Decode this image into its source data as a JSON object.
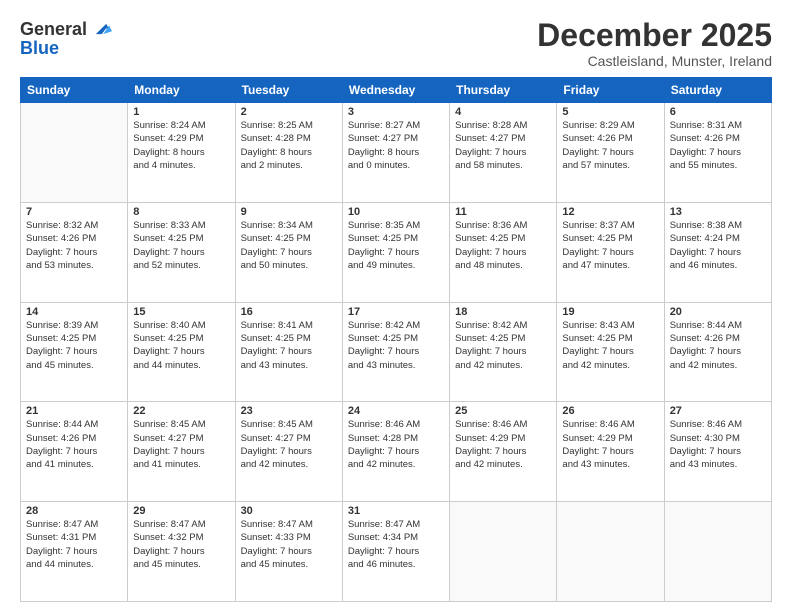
{
  "header": {
    "logo_general": "General",
    "logo_blue": "Blue",
    "month_title": "December 2025",
    "subtitle": "Castleisland, Munster, Ireland"
  },
  "days_of_week": [
    "Sunday",
    "Monday",
    "Tuesday",
    "Wednesday",
    "Thursday",
    "Friday",
    "Saturday"
  ],
  "weeks": [
    [
      {
        "day": "",
        "content": ""
      },
      {
        "day": "1",
        "content": "Sunrise: 8:24 AM\nSunset: 4:29 PM\nDaylight: 8 hours\nand 4 minutes."
      },
      {
        "day": "2",
        "content": "Sunrise: 8:25 AM\nSunset: 4:28 PM\nDaylight: 8 hours\nand 2 minutes."
      },
      {
        "day": "3",
        "content": "Sunrise: 8:27 AM\nSunset: 4:27 PM\nDaylight: 8 hours\nand 0 minutes."
      },
      {
        "day": "4",
        "content": "Sunrise: 8:28 AM\nSunset: 4:27 PM\nDaylight: 7 hours\nand 58 minutes."
      },
      {
        "day": "5",
        "content": "Sunrise: 8:29 AM\nSunset: 4:26 PM\nDaylight: 7 hours\nand 57 minutes."
      },
      {
        "day": "6",
        "content": "Sunrise: 8:31 AM\nSunset: 4:26 PM\nDaylight: 7 hours\nand 55 minutes."
      }
    ],
    [
      {
        "day": "7",
        "content": "Sunrise: 8:32 AM\nSunset: 4:26 PM\nDaylight: 7 hours\nand 53 minutes."
      },
      {
        "day": "8",
        "content": "Sunrise: 8:33 AM\nSunset: 4:25 PM\nDaylight: 7 hours\nand 52 minutes."
      },
      {
        "day": "9",
        "content": "Sunrise: 8:34 AM\nSunset: 4:25 PM\nDaylight: 7 hours\nand 50 minutes."
      },
      {
        "day": "10",
        "content": "Sunrise: 8:35 AM\nSunset: 4:25 PM\nDaylight: 7 hours\nand 49 minutes."
      },
      {
        "day": "11",
        "content": "Sunrise: 8:36 AM\nSunset: 4:25 PM\nDaylight: 7 hours\nand 48 minutes."
      },
      {
        "day": "12",
        "content": "Sunrise: 8:37 AM\nSunset: 4:25 PM\nDaylight: 7 hours\nand 47 minutes."
      },
      {
        "day": "13",
        "content": "Sunrise: 8:38 AM\nSunset: 4:24 PM\nDaylight: 7 hours\nand 46 minutes."
      }
    ],
    [
      {
        "day": "14",
        "content": "Sunrise: 8:39 AM\nSunset: 4:25 PM\nDaylight: 7 hours\nand 45 minutes."
      },
      {
        "day": "15",
        "content": "Sunrise: 8:40 AM\nSunset: 4:25 PM\nDaylight: 7 hours\nand 44 minutes."
      },
      {
        "day": "16",
        "content": "Sunrise: 8:41 AM\nSunset: 4:25 PM\nDaylight: 7 hours\nand 43 minutes."
      },
      {
        "day": "17",
        "content": "Sunrise: 8:42 AM\nSunset: 4:25 PM\nDaylight: 7 hours\nand 43 minutes."
      },
      {
        "day": "18",
        "content": "Sunrise: 8:42 AM\nSunset: 4:25 PM\nDaylight: 7 hours\nand 42 minutes."
      },
      {
        "day": "19",
        "content": "Sunrise: 8:43 AM\nSunset: 4:25 PM\nDaylight: 7 hours\nand 42 minutes."
      },
      {
        "day": "20",
        "content": "Sunrise: 8:44 AM\nSunset: 4:26 PM\nDaylight: 7 hours\nand 42 minutes."
      }
    ],
    [
      {
        "day": "21",
        "content": "Sunrise: 8:44 AM\nSunset: 4:26 PM\nDaylight: 7 hours\nand 41 minutes."
      },
      {
        "day": "22",
        "content": "Sunrise: 8:45 AM\nSunset: 4:27 PM\nDaylight: 7 hours\nand 41 minutes."
      },
      {
        "day": "23",
        "content": "Sunrise: 8:45 AM\nSunset: 4:27 PM\nDaylight: 7 hours\nand 42 minutes."
      },
      {
        "day": "24",
        "content": "Sunrise: 8:46 AM\nSunset: 4:28 PM\nDaylight: 7 hours\nand 42 minutes."
      },
      {
        "day": "25",
        "content": "Sunrise: 8:46 AM\nSunset: 4:29 PM\nDaylight: 7 hours\nand 42 minutes."
      },
      {
        "day": "26",
        "content": "Sunrise: 8:46 AM\nSunset: 4:29 PM\nDaylight: 7 hours\nand 43 minutes."
      },
      {
        "day": "27",
        "content": "Sunrise: 8:46 AM\nSunset: 4:30 PM\nDaylight: 7 hours\nand 43 minutes."
      }
    ],
    [
      {
        "day": "28",
        "content": "Sunrise: 8:47 AM\nSunset: 4:31 PM\nDaylight: 7 hours\nand 44 minutes."
      },
      {
        "day": "29",
        "content": "Sunrise: 8:47 AM\nSunset: 4:32 PM\nDaylight: 7 hours\nand 45 minutes."
      },
      {
        "day": "30",
        "content": "Sunrise: 8:47 AM\nSunset: 4:33 PM\nDaylight: 7 hours\nand 45 minutes."
      },
      {
        "day": "31",
        "content": "Sunrise: 8:47 AM\nSunset: 4:34 PM\nDaylight: 7 hours\nand 46 minutes."
      },
      {
        "day": "",
        "content": ""
      },
      {
        "day": "",
        "content": ""
      },
      {
        "day": "",
        "content": ""
      }
    ]
  ]
}
